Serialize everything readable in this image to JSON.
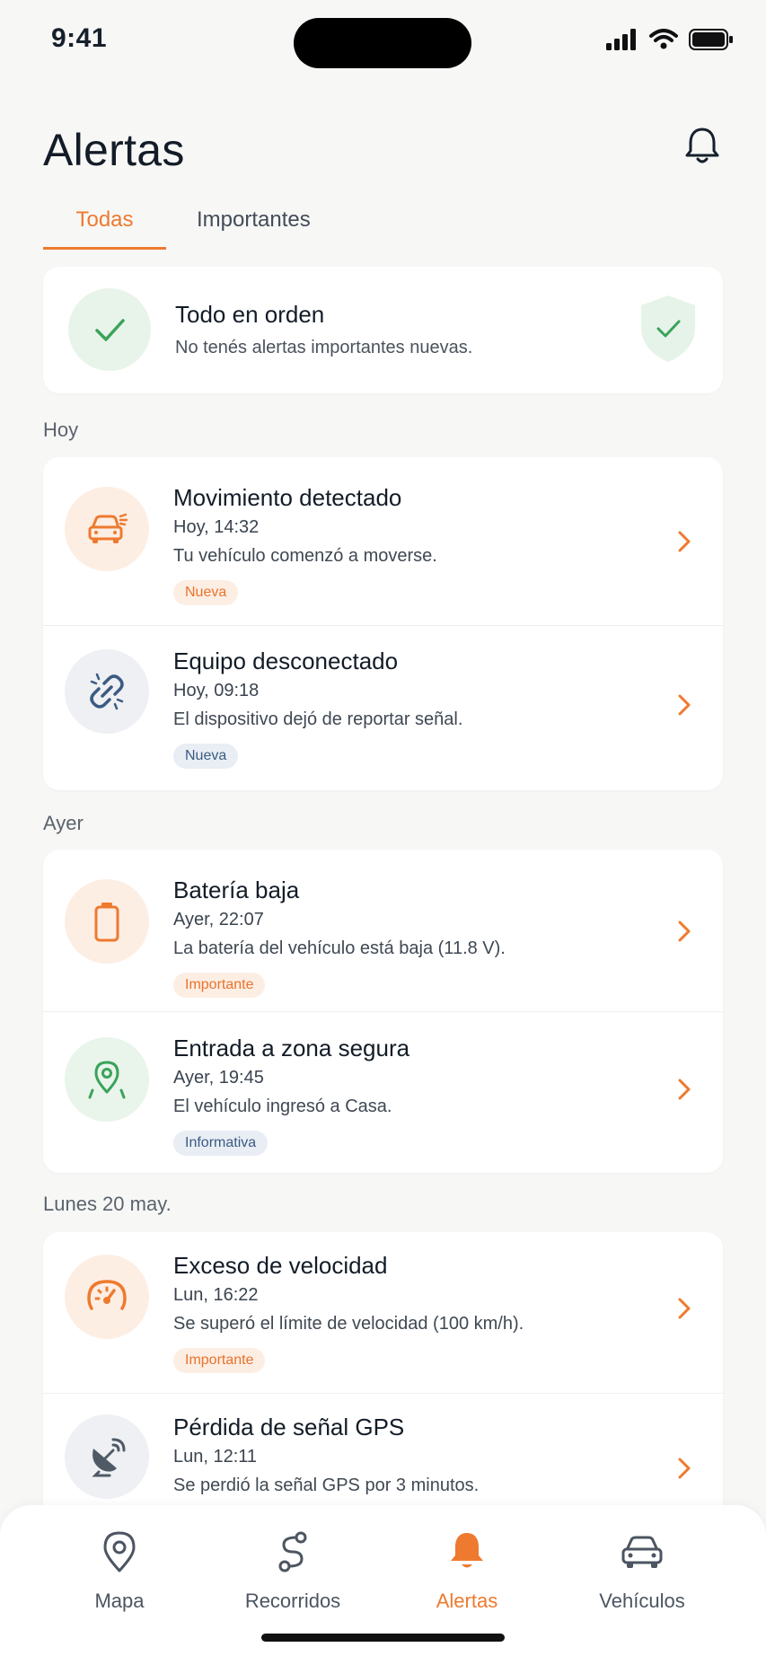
{
  "status_bar": {
    "time": "9:41"
  },
  "header": {
    "title": "Alertas"
  },
  "tabs": [
    {
      "label": "Todas"
    },
    {
      "label": "Importantes"
    }
  ],
  "summary": {
    "title": "Todo en orden",
    "subtitle": "No tenés alertas importantes nuevas."
  },
  "sections": [
    {
      "label": "Hoy",
      "alerts": [
        {
          "icon": "car-motion-icon",
          "title": "Movimiento detectado",
          "time": "Hoy, 14:32",
          "description": "Tu vehículo comenzó a moverse.",
          "badge": "Nueva",
          "badge_color": "#e8732a"
        },
        {
          "icon": "broken-link-icon",
          "title": "Equipo desconectado",
          "time": "Hoy, 09:18",
          "description": "El dispositivo dejó de reportar señal.",
          "badge": "Nueva",
          "badge_color": "#3b5b82"
        }
      ]
    },
    {
      "label": "Ayer",
      "alerts": [
        {
          "icon": "battery-icon",
          "title": "Batería baja",
          "time": "Ayer, 22:07",
          "description": "La batería del vehículo está baja (11.8 V).",
          "badge": "Importante",
          "badge_color": "#e8732a"
        },
        {
          "icon": "location-pin-icon",
          "title": "Entrada a zona segura",
          "time": "Ayer, 19:45",
          "description": "El vehículo ingresó a Casa.",
          "badge": "Informativa",
          "badge_color": "#3b5b82"
        }
      ]
    },
    {
      "label": "Lunes 20 may.",
      "alerts": [
        {
          "icon": "speedometer-icon",
          "title": "Exceso de velocidad",
          "time": "Lun, 16:22",
          "description": "Se superó el límite de velocidad (100 km/h).",
          "badge": "Importante",
          "badge_color": "#e8732a"
        },
        {
          "icon": "satellite-dish-icon",
          "title": "Pérdida de señal GPS",
          "time": "Lun, 12:11",
          "description": "Se perdió la señal GPS por 3 minutos."
        }
      ]
    }
  ],
  "bottom_nav": [
    {
      "label": "Mapa",
      "icon": "map-pin-icon"
    },
    {
      "label": "Recorridos",
      "icon": "route-icon"
    },
    {
      "label": "Alertas",
      "icon": "bell-icon",
      "active": true
    },
    {
      "label": "Vehículos",
      "icon": "car-icon"
    }
  ],
  "colors": {
    "accent": "#ee7a2f",
    "success": "#3aa35a",
    "background": "#f7f7f6"
  }
}
